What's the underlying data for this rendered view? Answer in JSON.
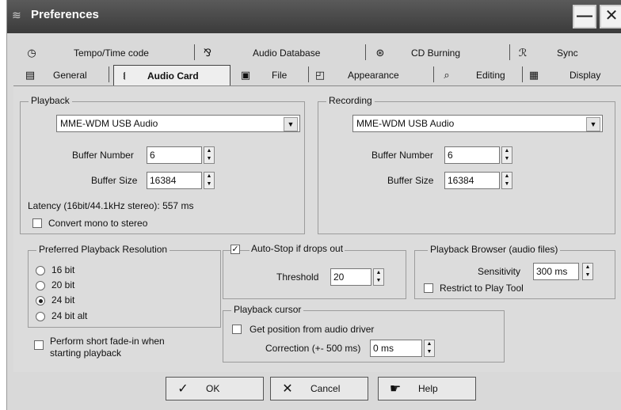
{
  "window": {
    "title": "Preferences",
    "minimize_glyph": "—",
    "close_glyph": "✕"
  },
  "tabs_row1": [
    {
      "label": "Tempo/Time code",
      "icon": "clock-icon"
    },
    {
      "label": "Audio Database",
      "icon": "database-icon"
    },
    {
      "label": "CD Burning",
      "icon": "cd-icon"
    },
    {
      "label": "Sync",
      "icon": "sync-icon"
    }
  ],
  "tabs_row2": [
    {
      "label": "General",
      "icon": "computer-icon"
    },
    {
      "label": "Audio Card",
      "icon": "audio-card-icon",
      "active": true
    },
    {
      "label": "File",
      "icon": "floppy-icon"
    },
    {
      "label": "Appearance",
      "icon": "appearance-icon"
    },
    {
      "label": "Editing",
      "icon": "edit-icon"
    },
    {
      "label": "Display",
      "icon": "display-icon"
    }
  ],
  "playback": {
    "title": "Playback",
    "device": "MME-WDM USB Audio",
    "buffer_number_label": "Buffer Number",
    "buffer_number": "6",
    "buffer_size_label": "Buffer Size",
    "buffer_size": "16384",
    "latency": "Latency (16bit/44.1kHz stereo): 557 ms",
    "convert_mono_label": "Convert mono to stereo",
    "convert_mono_checked": false
  },
  "recording": {
    "title": "Recording",
    "device": "MME-WDM USB Audio",
    "buffer_number_label": "Buffer Number",
    "buffer_number": "6",
    "buffer_size_label": "Buffer Size",
    "buffer_size": "16384"
  },
  "resolution": {
    "title": "Preferred Playback Resolution",
    "options": [
      "16 bit",
      "20 bit",
      "24 bit",
      "24 bit alt"
    ],
    "selected": "24 bit"
  },
  "fade_in": {
    "label_line1": "Perform short fade-in when",
    "label_line2": "starting playback",
    "checked": false
  },
  "auto_stop": {
    "label": "Auto-Stop if drops out",
    "checked": true,
    "threshold_label": "Threshold",
    "threshold": "20"
  },
  "browser": {
    "title": "Playback Browser (audio files)",
    "sensitivity_label": "Sensitivity",
    "sensitivity": "300 ms",
    "restrict_label": "Restrict to Play Tool",
    "restrict_checked": false
  },
  "cursor": {
    "title": "Playback cursor",
    "get_position_label": "Get position from audio driver",
    "get_position_checked": false,
    "correction_label": "Correction (+- 500 ms)",
    "correction": "0 ms"
  },
  "buttons": {
    "ok": "OK",
    "cancel": "Cancel",
    "help": "Help"
  },
  "glyphs": {
    "check": "✓",
    "dropdown": "▼",
    "spin_up": "▲",
    "spin_down": "▼"
  }
}
